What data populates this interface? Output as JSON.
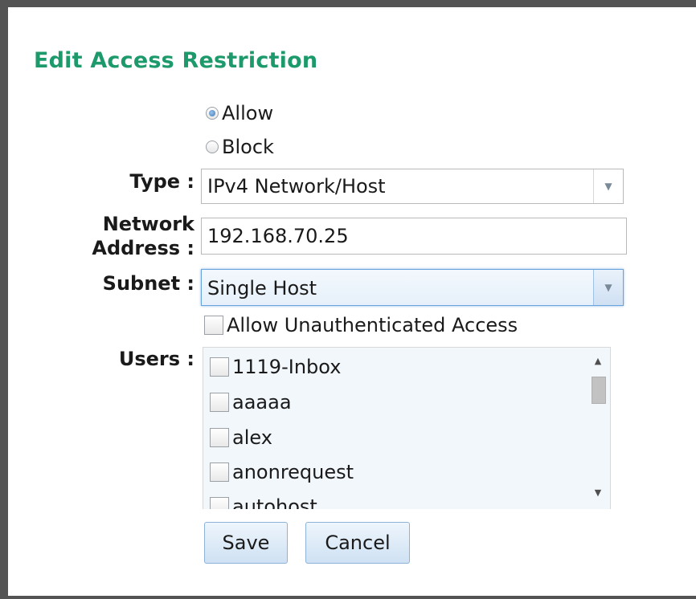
{
  "dialog": {
    "title": "Edit Access Restriction"
  },
  "action": {
    "options": [
      {
        "label": "Allow",
        "checked": true
      },
      {
        "label": "Block",
        "checked": false
      }
    ]
  },
  "type": {
    "label": "Type :",
    "value": "IPv4 Network/Host"
  },
  "network": {
    "label_line1": "Network",
    "label_line2": "Address :",
    "value": "192.168.70.25"
  },
  "subnet": {
    "label": "Subnet :",
    "value": "Single Host"
  },
  "unauth": {
    "label": "Allow Unauthenticated Access",
    "checked": false
  },
  "users": {
    "label": "Users :",
    "items": [
      {
        "name": "1119-Inbox",
        "checked": false
      },
      {
        "name": "aaaaa",
        "checked": false
      },
      {
        "name": "alex",
        "checked": false
      },
      {
        "name": "anonrequest",
        "checked": false
      },
      {
        "name": "autohost",
        "checked": false
      }
    ]
  },
  "buttons": {
    "save": "Save",
    "cancel": "Cancel"
  },
  "icons": {
    "dropdown": "chevron-down-icon",
    "scroll_up": "scroll-up-arrow-icon",
    "scroll_down": "scroll-down-arrow-icon"
  },
  "colors": {
    "title": "#1d9a6c",
    "frame": "#545454",
    "focus": "#6aa3dc"
  }
}
